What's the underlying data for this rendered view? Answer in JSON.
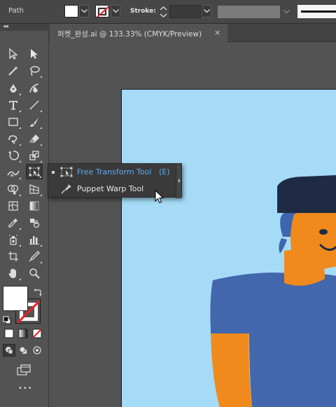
{
  "control_bar": {
    "object_type": "Path",
    "stroke_label": "Stroke:",
    "stroke_weight_value": "",
    "fill_color": "#ffffff",
    "stroke_color": "none"
  },
  "document_tab": {
    "title": "퍼켓_완성.ai @ 133.33% (CMYK/Preview)",
    "close": "×"
  },
  "tools_panel": {
    "collapse": "◂◂",
    "more_tools": "•••",
    "active_tool": "free-transform-tool"
  },
  "flyout": {
    "items": [
      {
        "label": "Free Transform Tool",
        "shortcut": "(E)",
        "selected": true,
        "icon": "free-transform-icon"
      },
      {
        "label": "Puppet Warp Tool",
        "shortcut": "",
        "selected": false,
        "icon": "puppet-warp-icon"
      }
    ]
  },
  "colors": {
    "panel": "#535353",
    "artboard": "#a5dbf6",
    "highlight_text": "#5fa9f0",
    "cap": "#1f2b44",
    "hair": "#3e65ad",
    "skin": "#f08a1c",
    "shirt": "#4267ad"
  }
}
